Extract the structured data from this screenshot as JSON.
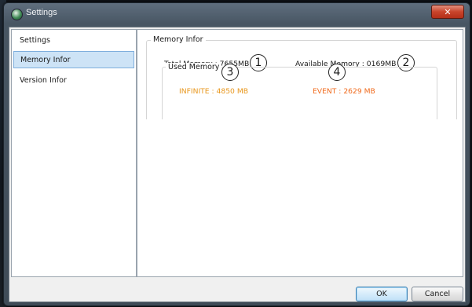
{
  "window": {
    "title": "Settings",
    "close_glyph": "✕"
  },
  "nav": {
    "items": [
      {
        "label": "Settings"
      },
      {
        "label": "Memory Infor"
      },
      {
        "label": "Version Infor"
      }
    ]
  },
  "memory_group": {
    "legend": "Memory Infor",
    "total": "Total Memory : 7655MB",
    "available": "Available Memory : 0169MB",
    "used_group": {
      "legend": "Used Memory",
      "infinite": "INFINITE : 4850 MB",
      "event": "EVENT : 2629 MB"
    }
  },
  "annotations": [
    "1",
    "2",
    "3",
    "4"
  ],
  "buttons": {
    "ok": "OK",
    "cancel": "Cancel"
  },
  "colors": {
    "infinite": "#e8961b",
    "event": "#f06a1c",
    "selection": "#cde3f6"
  }
}
